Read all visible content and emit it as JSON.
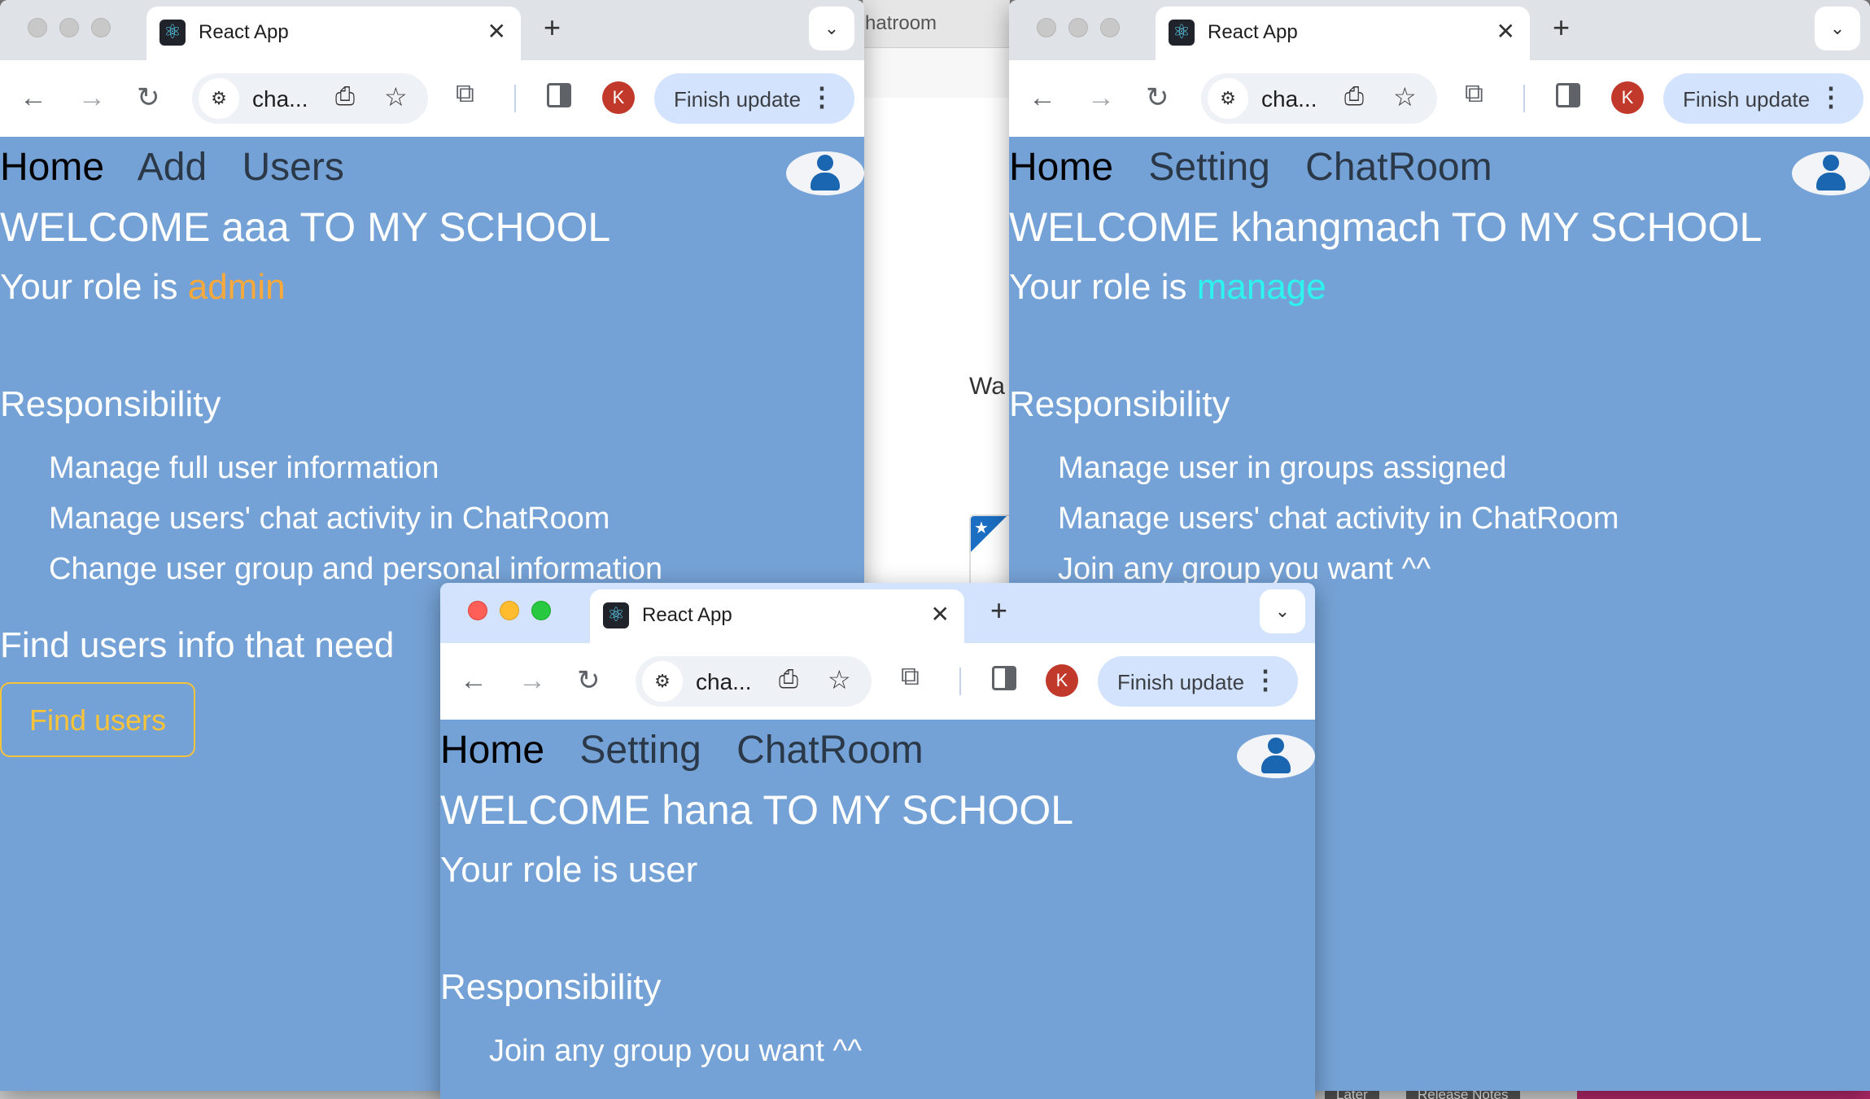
{
  "background": {
    "middle_window": {
      "tab_fragment": "hatroom",
      "label_fragment": "Wa"
    },
    "bottom_buttons": [
      "Later",
      "Release Notes"
    ]
  },
  "browser": {
    "tab_title": "React App",
    "url": "cha...",
    "update_label": "Finish update",
    "profile_initial": "K"
  },
  "windows": {
    "admin": {
      "nav": [
        "Home",
        "Add",
        "Users"
      ],
      "welcome": "WELCOME aaa TO MY SCHOOL",
      "role_prefix": "Your role is ",
      "role": "admin",
      "responsibility_heading": "Responsibility",
      "responsibilities": [
        "Manage full user information",
        "Manage users' chat activity in ChatRoom",
        "Change user group and personal information"
      ],
      "find_heading": "Find users info that need",
      "find_button": "Find users"
    },
    "manage": {
      "nav": [
        "Home",
        "Setting",
        "ChatRoom"
      ],
      "welcome": "WELCOME khangmach TO MY SCHOOL",
      "role_prefix": "Your role is ",
      "role": "manage",
      "responsibility_heading": "Responsibility",
      "responsibilities": [
        "Manage user in groups assigned",
        "Manage users' chat activity in ChatRoom",
        "Join any group you want ^^"
      ]
    },
    "user": {
      "nav": [
        "Home",
        "Setting",
        "ChatRoom"
      ],
      "welcome": "WELCOME hana TO MY SCHOOL",
      "role_text": "Your role is user",
      "responsibility_heading": "Responsibility",
      "responsibilities": [
        "Join any group you want ^^"
      ]
    }
  },
  "colors": {
    "page_bg": "#75a2d6",
    "admin_role": "#f7a93b",
    "manage_role": "#2ef4f0",
    "find_button": "#f7c33b"
  },
  "icons": [
    "react-favicon",
    "close-icon",
    "plus-icon",
    "chevron-down-icon",
    "back-arrow-icon",
    "forward-arrow-icon",
    "reload-icon",
    "site-settings-icon",
    "install-icon",
    "star-icon",
    "extensions-icon",
    "side-panel-icon",
    "more-vert-icon",
    "user-avatar-icon"
  ]
}
